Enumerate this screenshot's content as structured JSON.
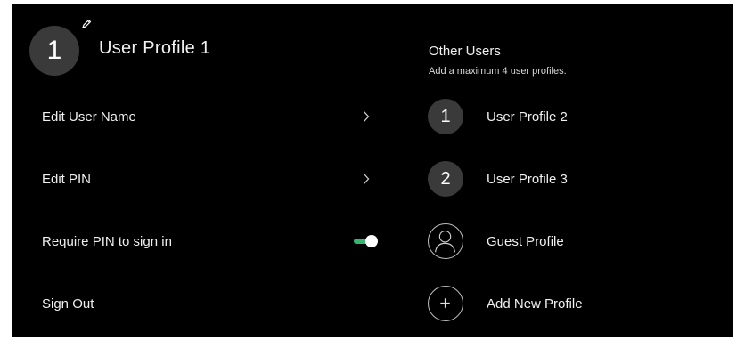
{
  "current_user": {
    "avatar_number": "1",
    "name": "User Profile 1"
  },
  "menu": {
    "edit_user_name": "Edit User Name",
    "edit_pin": "Edit PIN",
    "require_pin": "Require PIN to sign in",
    "require_pin_enabled": true,
    "sign_out": "Sign Out"
  },
  "other_users": {
    "title": "Other Users",
    "subtitle": "Add a maximum 4 user profiles.",
    "profiles": [
      {
        "avatar": "1",
        "name": "User Profile 2"
      },
      {
        "avatar": "2",
        "name": "User Profile 3"
      },
      {
        "avatar_icon": "person-icon",
        "name": "Guest Profile"
      },
      {
        "avatar_icon": "plus-icon",
        "name": "Add New Profile"
      }
    ]
  },
  "colors": {
    "background": "#000000",
    "avatar": "#3a3a3a",
    "toggle_on": "#2fb86e"
  }
}
